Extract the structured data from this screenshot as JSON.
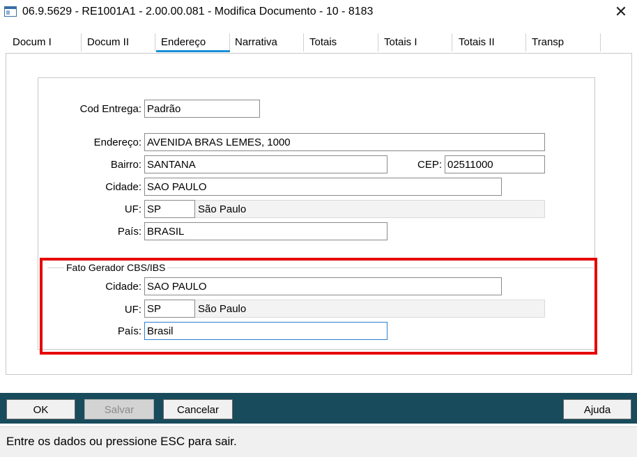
{
  "window": {
    "title": "06.9.5629 - RE1001A1 - 2.00.00.081 - Modifica Documento - 10 - 8183",
    "close_symbol": "✕"
  },
  "tabs": [
    {
      "label": "Docum I"
    },
    {
      "label": "Docum II"
    },
    {
      "label": "Endereço"
    },
    {
      "label": "Narrativa"
    },
    {
      "label": "Totais"
    },
    {
      "label": "Totais I"
    },
    {
      "label": "Totais II"
    },
    {
      "label": "Transp"
    }
  ],
  "active_tab": "Endereço",
  "colors": {
    "highlight": "#e60000",
    "tab_accent": "#1a8fd6",
    "footer": "#184b5c"
  },
  "form": {
    "cod_entrega": {
      "label": "Cod Entrega:",
      "value": "Padrão"
    },
    "endereco": {
      "label": "Endereço:",
      "value": "AVENIDA BRAS LEMES, 1000"
    },
    "bairro": {
      "label": "Bairro:",
      "value": "SANTANA"
    },
    "cep": {
      "label": "CEP:",
      "value": "02511000"
    },
    "cidade": {
      "label": "Cidade:",
      "value": "SAO PAULO"
    },
    "uf": {
      "label": "UF:",
      "value": "SP",
      "description": "São Paulo"
    },
    "pais": {
      "label": "País:",
      "value": "BRASIL"
    }
  },
  "fato_gerador": {
    "title": "Fato Gerador CBS/IBS",
    "cidade": {
      "label": "Cidade:",
      "value": "SAO PAULO"
    },
    "uf": {
      "label": "UF:",
      "value": "SP",
      "description": "São Paulo"
    },
    "pais": {
      "label": "País:",
      "value": "Brasil"
    }
  },
  "buttons": {
    "ok": "OK",
    "salvar": "Salvar",
    "cancelar": "Cancelar",
    "ajuda": "Ajuda"
  },
  "status": "Entre os dados ou pressione ESC para sair."
}
